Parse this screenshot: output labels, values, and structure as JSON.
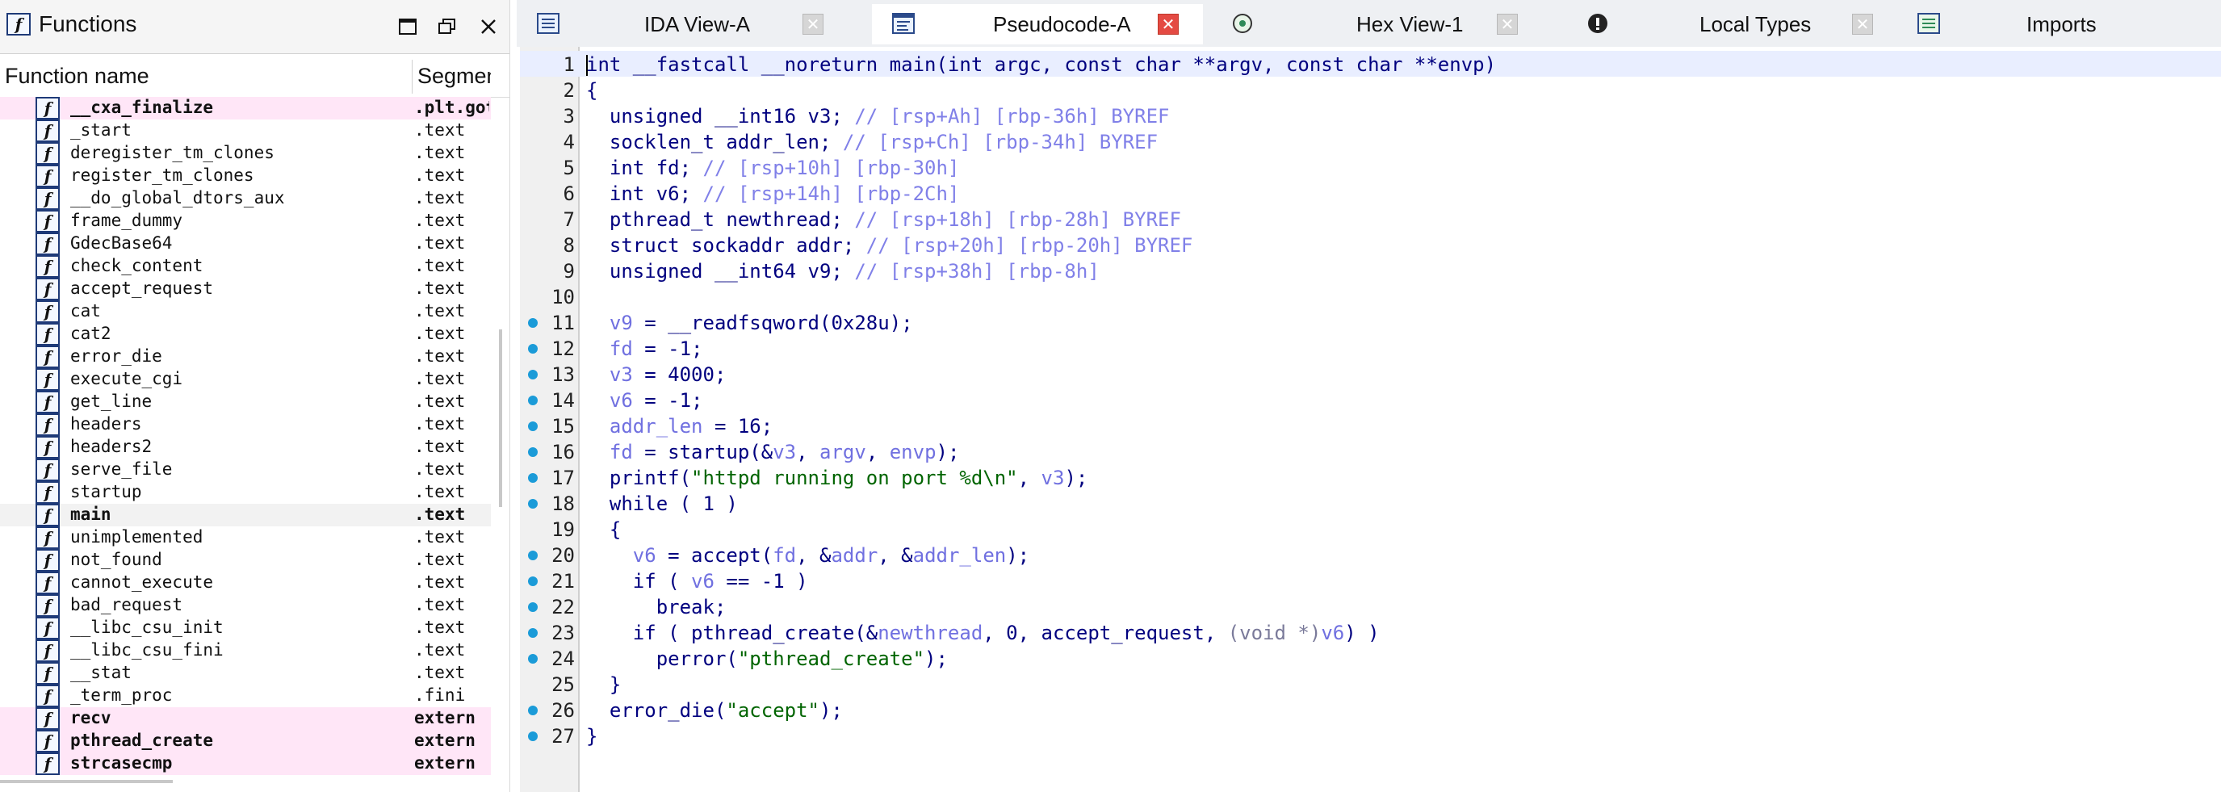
{
  "functions_pane": {
    "title": "Functions",
    "col_name": "Function name",
    "col_segment": "Segmen",
    "rows": [
      {
        "name": "__cxa_finalize",
        "segment": ".plt.got",
        "style": "pink-bold"
      },
      {
        "name": "_start",
        "segment": ".text",
        "style": ""
      },
      {
        "name": "deregister_tm_clones",
        "segment": ".text",
        "style": ""
      },
      {
        "name": "register_tm_clones",
        "segment": ".text",
        "style": ""
      },
      {
        "name": "__do_global_dtors_aux",
        "segment": ".text",
        "style": ""
      },
      {
        "name": "frame_dummy",
        "segment": ".text",
        "style": ""
      },
      {
        "name": "GdecBase64",
        "segment": ".text",
        "style": ""
      },
      {
        "name": "check_content",
        "segment": ".text",
        "style": ""
      },
      {
        "name": "accept_request",
        "segment": ".text",
        "style": ""
      },
      {
        "name": "cat",
        "segment": ".text",
        "style": ""
      },
      {
        "name": "cat2",
        "segment": ".text",
        "style": ""
      },
      {
        "name": "error_die",
        "segment": ".text",
        "style": ""
      },
      {
        "name": "execute_cgi",
        "segment": ".text",
        "style": ""
      },
      {
        "name": "get_line",
        "segment": ".text",
        "style": ""
      },
      {
        "name": "headers",
        "segment": ".text",
        "style": ""
      },
      {
        "name": "headers2",
        "segment": ".text",
        "style": ""
      },
      {
        "name": "serve_file",
        "segment": ".text",
        "style": ""
      },
      {
        "name": "startup",
        "segment": ".text",
        "style": ""
      },
      {
        "name": "main",
        "segment": ".text",
        "style": "selected-bold"
      },
      {
        "name": "unimplemented",
        "segment": ".text",
        "style": ""
      },
      {
        "name": "not_found",
        "segment": ".text",
        "style": ""
      },
      {
        "name": "cannot_execute",
        "segment": ".text",
        "style": ""
      },
      {
        "name": "bad_request",
        "segment": ".text",
        "style": ""
      },
      {
        "name": "__libc_csu_init",
        "segment": ".text",
        "style": ""
      },
      {
        "name": "__libc_csu_fini",
        "segment": ".text",
        "style": ""
      },
      {
        "name": "__stat",
        "segment": ".text",
        "style": ""
      },
      {
        "name": "_term_proc",
        "segment": ".fini",
        "style": ""
      },
      {
        "name": "recv",
        "segment": "extern",
        "style": "pink-bold"
      },
      {
        "name": "pthread_create",
        "segment": "extern",
        "style": "pink-bold"
      },
      {
        "name": "strcasecmp",
        "segment": "extern",
        "style": "pink-bold"
      }
    ]
  },
  "tabs": [
    {
      "label": "IDA View-A",
      "icon": "ida-view-icon",
      "active": false
    },
    {
      "label": "Pseudocode-A",
      "icon": "pseudocode-icon",
      "active": true
    },
    {
      "label": "Hex View-1",
      "icon": "hex-view-icon",
      "active": false
    },
    {
      "label": "Local Types",
      "icon": "local-types-icon",
      "active": false
    },
    {
      "label": "Imports",
      "icon": "imports-icon",
      "active": false
    }
  ],
  "code": {
    "lines": [
      {
        "n": "1",
        "bp": false,
        "html": "int __fastcall __noreturn main(int argc, const char **argv, const char **envp)"
      },
      {
        "n": "2",
        "bp": false,
        "html": "{"
      },
      {
        "n": "3",
        "bp": false,
        "html": "  unsigned __int16 v3; <span class=\"cm\">// [rsp+Ah] [rbp-36h] BYREF</span>"
      },
      {
        "n": "4",
        "bp": false,
        "html": "  socklen_t addr_len; <span class=\"cm\">// [rsp+Ch] [rbp-34h] BYREF</span>"
      },
      {
        "n": "5",
        "bp": false,
        "html": "  int fd; <span class=\"cm\">// [rsp+10h] [rbp-30h]</span>"
      },
      {
        "n": "6",
        "bp": false,
        "html": "  int v6; <span class=\"cm\">// [rsp+14h] [rbp-2Ch]</span>"
      },
      {
        "n": "7",
        "bp": false,
        "html": "  pthread_t newthread; <span class=\"cm\">// [rsp+18h] [rbp-28h] BYREF</span>"
      },
      {
        "n": "8",
        "bp": false,
        "html": "  struct sockaddr addr; <span class=\"cm\">// [rsp+20h] [rbp-20h] BYREF</span>"
      },
      {
        "n": "9",
        "bp": false,
        "html": "  unsigned __int64 v9; <span class=\"cm\">// [rsp+38h] [rbp-8h]</span>"
      },
      {
        "n": "10",
        "bp": false,
        "html": ""
      },
      {
        "n": "11",
        "bp": true,
        "html": "  <span class=\"v\">v9</span> = __readfsqword(0x28u);"
      },
      {
        "n": "12",
        "bp": true,
        "html": "  <span class=\"v\">fd</span> = -1;"
      },
      {
        "n": "13",
        "bp": true,
        "html": "  <span class=\"v\">v3</span> = 4000;"
      },
      {
        "n": "14",
        "bp": true,
        "html": "  <span class=\"v\">v6</span> = -1;"
      },
      {
        "n": "15",
        "bp": true,
        "html": "  <span class=\"v\">addr_len</span> = 16;"
      },
      {
        "n": "16",
        "bp": true,
        "html": "  <span class=\"v\">fd</span> = startup(&amp;<span class=\"v\">v3</span>, <span class=\"v\">argv</span>, <span class=\"v\">envp</span>);"
      },
      {
        "n": "17",
        "bp": true,
        "html": "  printf(<span class=\"st\">\"httpd running on port %d\\n\"</span>, <span class=\"v\">v3</span>);"
      },
      {
        "n": "18",
        "bp": true,
        "html": "  while ( 1 )"
      },
      {
        "n": "19",
        "bp": false,
        "html": "  {"
      },
      {
        "n": "20",
        "bp": true,
        "html": "    <span class=\"v\">v6</span> = accept(<span class=\"v\">fd</span>, &amp;<span class=\"v\">addr</span>, &amp;<span class=\"v\">addr_len</span>);"
      },
      {
        "n": "21",
        "bp": true,
        "html": "    if ( <span class=\"v\">v6</span> == -1 )"
      },
      {
        "n": "22",
        "bp": true,
        "html": "      break;"
      },
      {
        "n": "23",
        "bp": true,
        "html": "    if ( pthread_create(&amp;<span class=\"v\">newthread</span>, 0, accept_request, <span class=\"gr\">(void *)</span><span class=\"v\">v6</span>) )"
      },
      {
        "n": "24",
        "bp": true,
        "html": "      perror(<span class=\"st\">\"pthread_create\"</span>);"
      },
      {
        "n": "25",
        "bp": false,
        "html": "  }"
      },
      {
        "n": "26",
        "bp": true,
        "html": "  error_die(<span class=\"st\">\"accept\"</span>);"
      },
      {
        "n": "27",
        "bp": true,
        "html": "}"
      }
    ]
  },
  "colors": {
    "accent_blue": "#1b9bd8",
    "keyword_navy": "#00007f",
    "var_purple": "#7070e0",
    "string_green": "#006400",
    "import_pink": "#ffe6f7",
    "active_close_red": "#e44a43"
  }
}
